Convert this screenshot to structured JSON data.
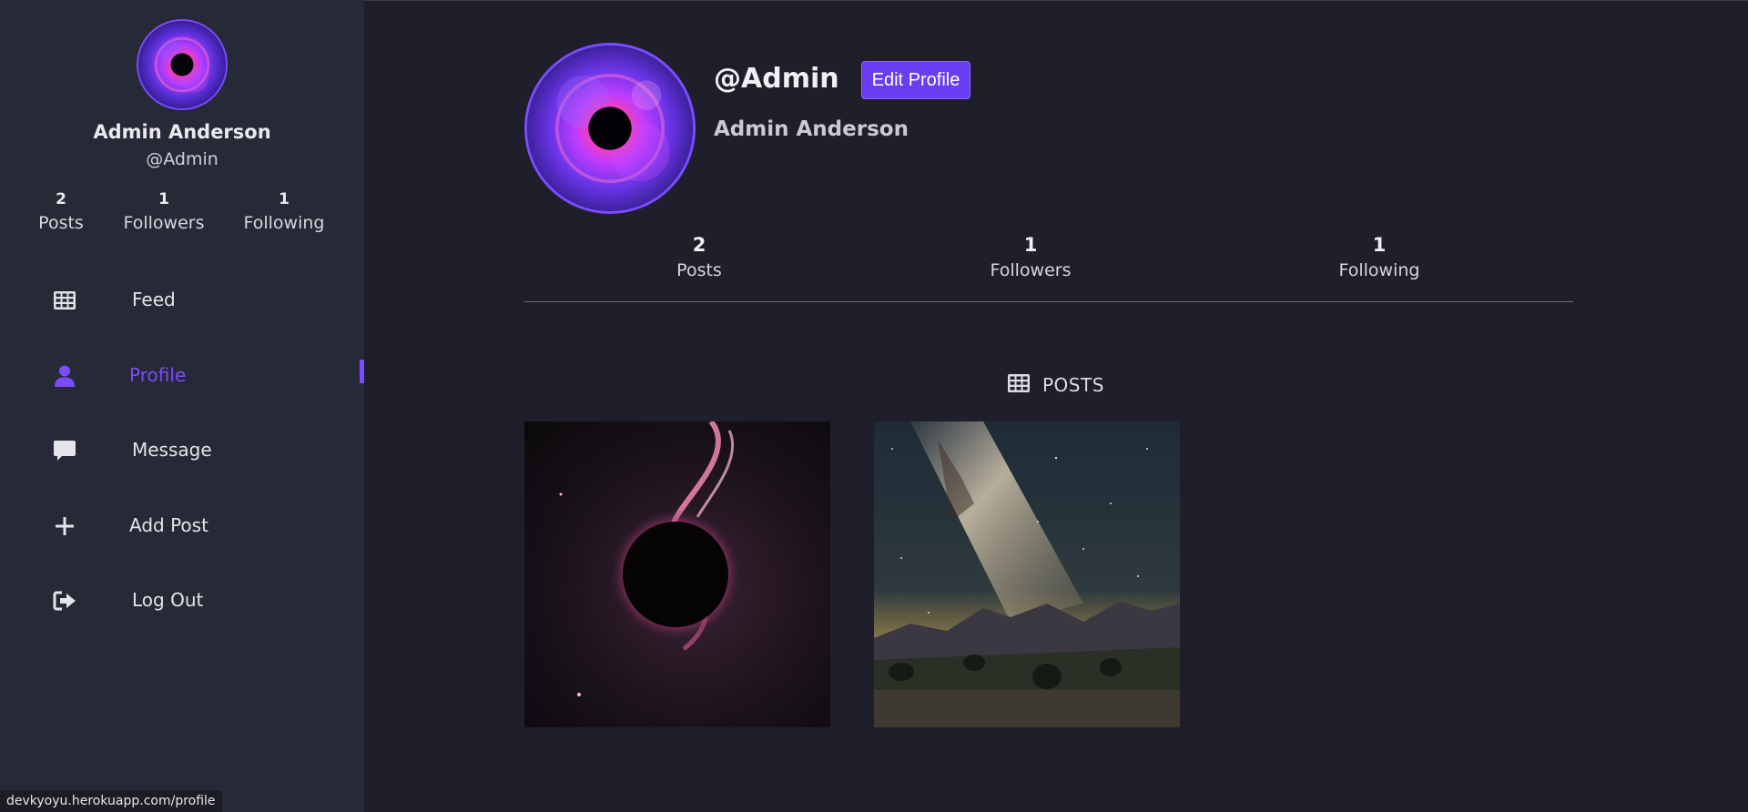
{
  "sidebar": {
    "user": {
      "name": "Admin Anderson",
      "handle": "@Admin"
    },
    "stats": [
      {
        "value": "2",
        "label": "Posts"
      },
      {
        "value": "1",
        "label": "Followers"
      },
      {
        "value": "1",
        "label": "Following"
      }
    ],
    "nav": [
      {
        "label": "Feed",
        "icon": "grid-icon",
        "active": false
      },
      {
        "label": "Profile",
        "icon": "user-icon",
        "active": true
      },
      {
        "label": "Message",
        "icon": "message-icon",
        "active": false
      },
      {
        "label": "Add Post",
        "icon": "plus-icon",
        "active": false
      },
      {
        "label": "Log Out",
        "icon": "logout-icon",
        "active": false
      }
    ]
  },
  "profile": {
    "handle": "@Admin",
    "edit_button": "Edit Profile",
    "full_name": "Admin Anderson",
    "stats": [
      {
        "value": "2",
        "label": "Posts"
      },
      {
        "value": "1",
        "label": "Followers"
      },
      {
        "value": "1",
        "label": "Following"
      }
    ],
    "posts_heading": "POSTS",
    "posts": [
      {
        "image": "black hole with pink flames"
      },
      {
        "image": "milky way over mountains"
      }
    ]
  },
  "status_bar": {
    "url": "devkyoyu.herokuapp.com/profile"
  },
  "colors": {
    "accent": "#7b4bff",
    "button": "#6a3df0",
    "background": "#1e1f2b",
    "sidebar": "#252a36"
  }
}
